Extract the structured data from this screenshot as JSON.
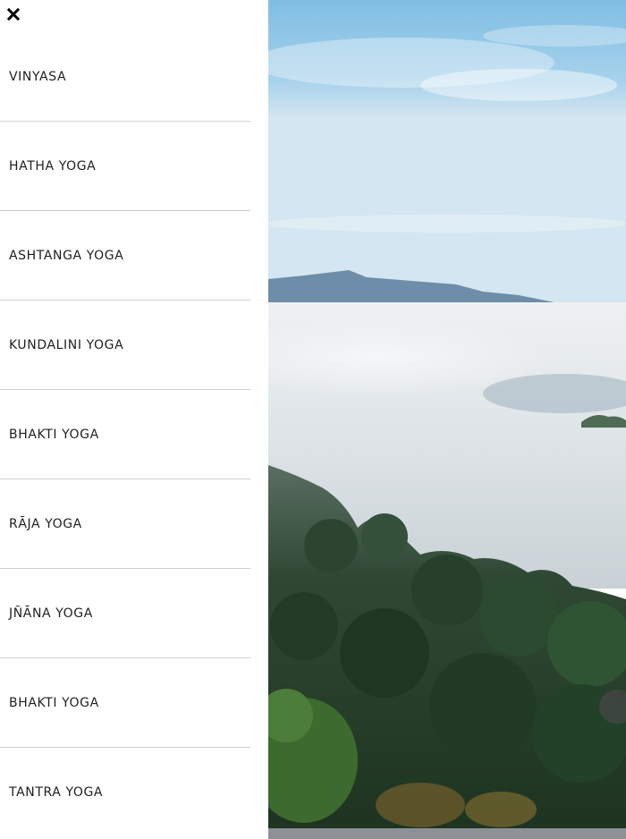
{
  "menu": {
    "close_icon": "close-icon",
    "items": [
      {
        "label": "VINYASA"
      },
      {
        "label": "HATHA YOGA"
      },
      {
        "label": "ASHTANGA YOGA"
      },
      {
        "label": "KUNDALINI YOGA"
      },
      {
        "label": "BHAKTI YOGA"
      },
      {
        "label": "RĀJA YOGA"
      },
      {
        "label": "JÑĀNA YOGA"
      },
      {
        "label": "BHAKTI YOGA"
      },
      {
        "label": "TANTRA YOGA"
      }
    ]
  },
  "colors": {
    "panel_bg": "#ffffff",
    "text": "#1f1f1f",
    "divider": "#cfcfcf",
    "sky": "#8ec4e4",
    "forest": "#2d4a2c"
  }
}
